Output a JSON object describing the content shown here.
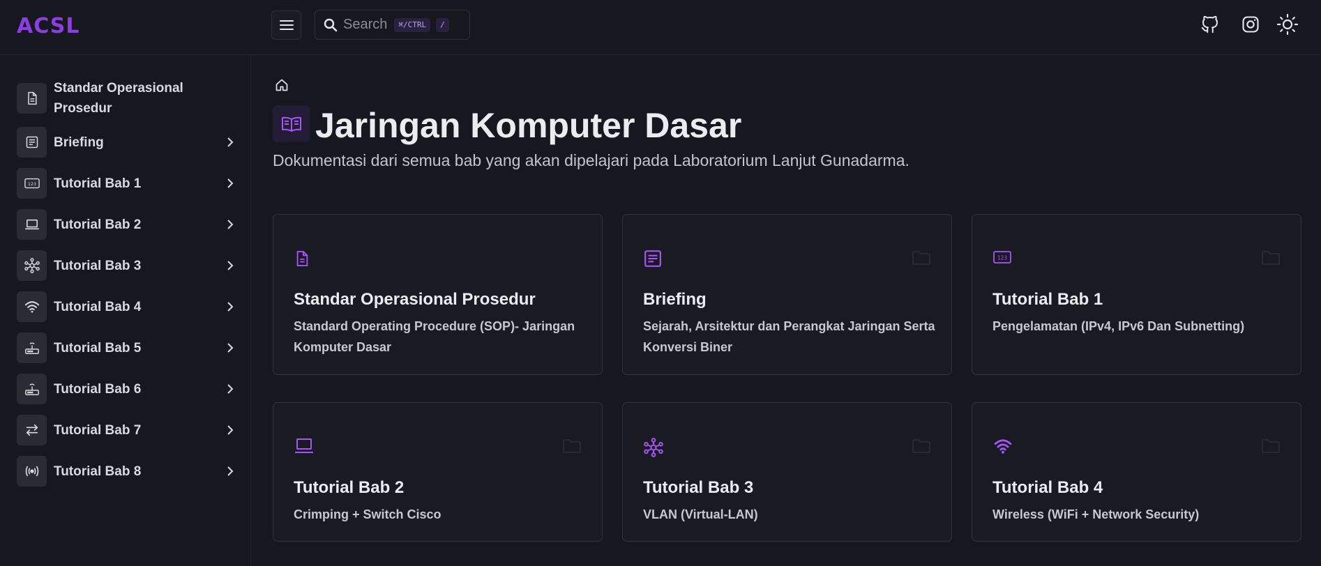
{
  "header": {
    "logo": "ACSL",
    "search_placeholder": "Search",
    "search_shortcut": "⌘/CTRL",
    "search_shortcut_key": "/",
    "icons": [
      "github-icon",
      "instagram-icon",
      "sun-icon"
    ]
  },
  "sidebar": {
    "items": [
      {
        "label": "Standar Operasional Prosedur",
        "icon": "document-icon",
        "has_children": false
      },
      {
        "label": "Briefing",
        "icon": "newspaper-icon",
        "has_children": true
      },
      {
        "label": "Tutorial Bab 1",
        "icon": "numbers-icon",
        "has_children": true
      },
      {
        "label": "Tutorial Bab 2",
        "icon": "laptop-icon",
        "has_children": true
      },
      {
        "label": "Tutorial Bab 3",
        "icon": "network-icon",
        "has_children": true
      },
      {
        "label": "Tutorial Bab 4",
        "icon": "wifi-icon",
        "has_children": true
      },
      {
        "label": "Tutorial Bab 5",
        "icon": "router-icon",
        "has_children": true
      },
      {
        "label": "Tutorial Bab 6",
        "icon": "router-icon",
        "has_children": true
      },
      {
        "label": "Tutorial Bab 7",
        "icon": "arrows-icon",
        "has_children": true
      },
      {
        "label": "Tutorial Bab 8",
        "icon": "broadcast-icon",
        "has_children": true
      }
    ]
  },
  "main": {
    "title": "Jaringan Komputer Dasar",
    "title_icon": "book-icon",
    "description": "Dokumentasi dari semua bab yang akan dipelajari pada Laboratorium Lanjut Gunadarma.",
    "cards": [
      {
        "title": "Standar Operasional Prosedur",
        "desc": "Standard Operating Procedure (SOP)- Jaringan Komputer Dasar",
        "icon": "document-icon",
        "folder": false
      },
      {
        "title": "Briefing",
        "desc": "Sejarah, Arsitektur dan Perangkat Jaringan Serta Konversi Biner",
        "icon": "newspaper-icon",
        "folder": true
      },
      {
        "title": "Tutorial Bab 1",
        "desc": "Pengelamatan (IPv4, IPv6 Dan Subnetting)",
        "icon": "numbers-icon",
        "folder": true
      },
      {
        "title": "Tutorial Bab 2",
        "desc": "Crimping + Switch Cisco",
        "icon": "laptop-icon",
        "folder": true
      },
      {
        "title": "Tutorial Bab 3",
        "desc": "VLAN (Virtual-LAN)",
        "icon": "network-icon",
        "folder": true
      },
      {
        "title": "Tutorial Bab 4",
        "desc": "Wireless (WiFi + Network Security)",
        "icon": "wifi-icon",
        "folder": true
      }
    ]
  },
  "colors": {
    "accent": "#a855f7",
    "logo": "#8b3fe0",
    "background": "#171720"
  }
}
